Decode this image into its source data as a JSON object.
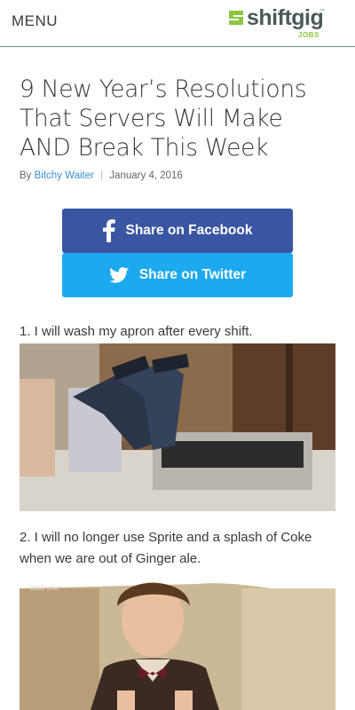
{
  "header": {
    "menu_label": "MENU",
    "logo_text": "shiftgig",
    "logo_tm": "™",
    "logo_sub": "JOBS"
  },
  "article": {
    "title": "9 New Year’s Resolutions That Servers Will Make AND Break This Week",
    "byline_prefix": "By",
    "author": "Bitchy Waiter",
    "separator": "|",
    "date": "January 4, 2016"
  },
  "share": {
    "facebook_label": "Share on Facebook",
    "twitter_label": "Share on Twitter",
    "facebook_color": "#3a56a3",
    "twitter_color": "#1da9ef"
  },
  "items": [
    {
      "text": "1. I will wash my apron after every shift.",
      "image": "gif-legs-in-washing-machine"
    },
    {
      "text": "2. I will no longer use Sprite and a splash of Coke when we are out of Ginger ale.",
      "image": "gif-man-in-bowtie"
    }
  ],
  "colors": {
    "accent_green": "#8cc63f",
    "link_blue": "#3a8fd6"
  }
}
